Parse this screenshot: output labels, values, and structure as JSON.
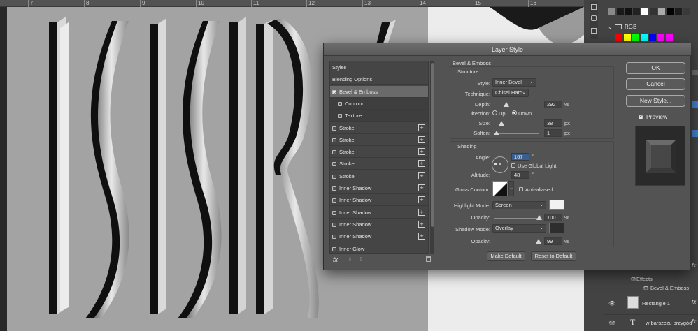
{
  "ruler": {
    "ticks": [
      "7",
      "8",
      "9",
      "10",
      "11",
      "12",
      "13",
      "14",
      "15",
      "16"
    ]
  },
  "panel": {
    "colors": {
      "grays": [
        "#8a8a8a",
        "#1a1a1a",
        "#111111",
        "#222222",
        "#ffffff",
        "#333333",
        "#aaaaaa",
        "#000000",
        "#1c1c1c",
        "#3a3a3a"
      ],
      "rgb": [
        "#ff0000",
        "#ffff00",
        "#00ff00",
        "#00ffff",
        "#0000ff",
        "#ff00ff",
        "#ff00ff"
      ]
    },
    "rgb_folder_label": "RGB",
    "effects_label": "Effects",
    "bevel_effect_label": "Bevel & Emboss",
    "layer1_name": "Rectangle 1",
    "layer2_name": "w barszczu przygód",
    "fx_label": "fx"
  },
  "dialog": {
    "title": "Layer Style",
    "styles_list": [
      {
        "label": "Styles",
        "kind": "header"
      },
      {
        "label": "Blending Options",
        "kind": "header"
      },
      {
        "label": "Bevel & Emboss",
        "kind": "item",
        "checked": true,
        "selected": true
      },
      {
        "label": "Contour",
        "kind": "sub",
        "checked": false
      },
      {
        "label": "Texture",
        "kind": "sub",
        "checked": false
      },
      {
        "label": "Stroke",
        "kind": "item",
        "plus": true
      },
      {
        "label": "Stroke",
        "kind": "item",
        "plus": true
      },
      {
        "label": "Stroke",
        "kind": "item",
        "plus": true
      },
      {
        "label": "Stroke",
        "kind": "item",
        "plus": true
      },
      {
        "label": "Stroke",
        "kind": "item",
        "plus": true
      },
      {
        "label": "Inner Shadow",
        "kind": "item",
        "plus": true
      },
      {
        "label": "Inner Shadow",
        "kind": "item",
        "plus": true
      },
      {
        "label": "Inner Shadow",
        "kind": "item",
        "plus": true
      },
      {
        "label": "Inner Shadow",
        "kind": "item",
        "plus": true
      },
      {
        "label": "Inner Shadow",
        "kind": "item",
        "plus": true
      },
      {
        "label": "Inner Glow",
        "kind": "item"
      }
    ],
    "fx_label": "fx",
    "bevel": {
      "section_title": "Bevel & Emboss",
      "structure_title": "Structure",
      "style_label": "Style:",
      "style_value": "Inner Bevel",
      "technique_label": "Technique:",
      "technique_value": "Chisel Hard",
      "depth_label": "Depth:",
      "depth_value": "292",
      "depth_unit": "%",
      "direction_label": "Direction:",
      "dir_up": "Up",
      "dir_down": "Down",
      "size_label": "Size:",
      "size_value": "38",
      "size_unit": "px",
      "soften_label": "Soften:",
      "soften_value": "1",
      "soften_unit": "px"
    },
    "shading": {
      "title": "Shading",
      "angle_label": "Angle:",
      "angle_value": "167",
      "angle_unit": "°",
      "global_light_label": "Use Global Light",
      "altitude_label": "Altitude:",
      "altitude_value": "48",
      "altitude_unit": "°",
      "gloss_label": "Gloss Contour:",
      "anti_aliased_label": "Anti-aliased",
      "highlight_mode_label": "Highlight Mode:",
      "highlight_mode_value": "Screen",
      "highlight_color": "#f2f2f2",
      "highlight_opacity_label": "Opacity:",
      "highlight_opacity_value": "100",
      "shadow_mode_label": "Shadow Mode:",
      "shadow_mode_value": "Overlay",
      "shadow_color": "#2e2e2e",
      "shadow_opacity_label": "Opacity:",
      "shadow_opacity_value": "99",
      "pct": "%"
    },
    "make_default": "Make Default",
    "reset_default": "Reset to Default",
    "ok": "OK",
    "cancel": "Cancel",
    "new_style": "New Style...",
    "preview_label": "Preview"
  }
}
